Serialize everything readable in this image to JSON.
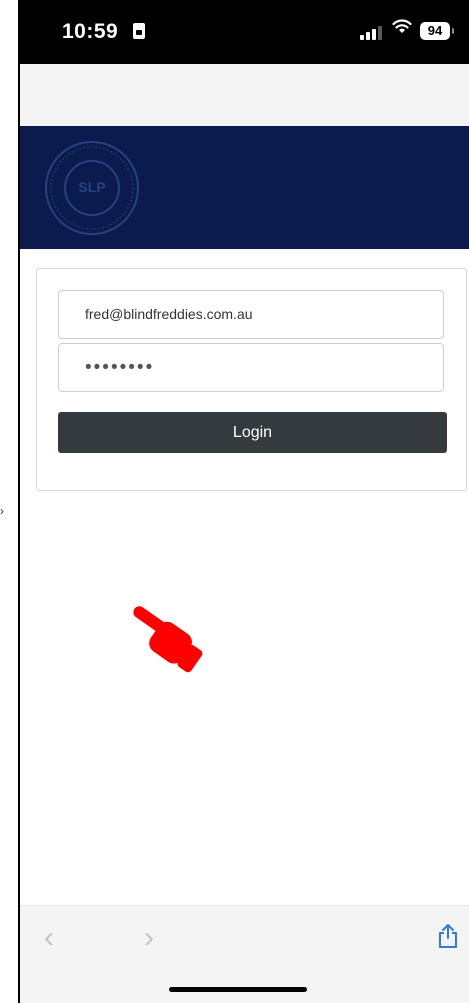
{
  "status_bar": {
    "time": "10:59",
    "battery": "94"
  },
  "login": {
    "email_value": "fred@blindfreddies.com.au",
    "password_mask": "••••••••",
    "button_label": "Login"
  },
  "logo": {
    "text": "SLP"
  },
  "browser_bar": {
    "back_glyph": "‹",
    "forward_glyph": "›"
  },
  "icons": {
    "status": [
      "id-card-icon",
      "cellular-signal-icon",
      "wifi-icon",
      "battery-icon"
    ],
    "browser": [
      "back-icon",
      "forward-icon",
      "share-icon"
    ],
    "annotation": [
      "pointing-hand-icon"
    ]
  },
  "colors": {
    "banner": "#0b1b4d",
    "login_button": "#353a3f",
    "pointer": "#ff0000"
  }
}
